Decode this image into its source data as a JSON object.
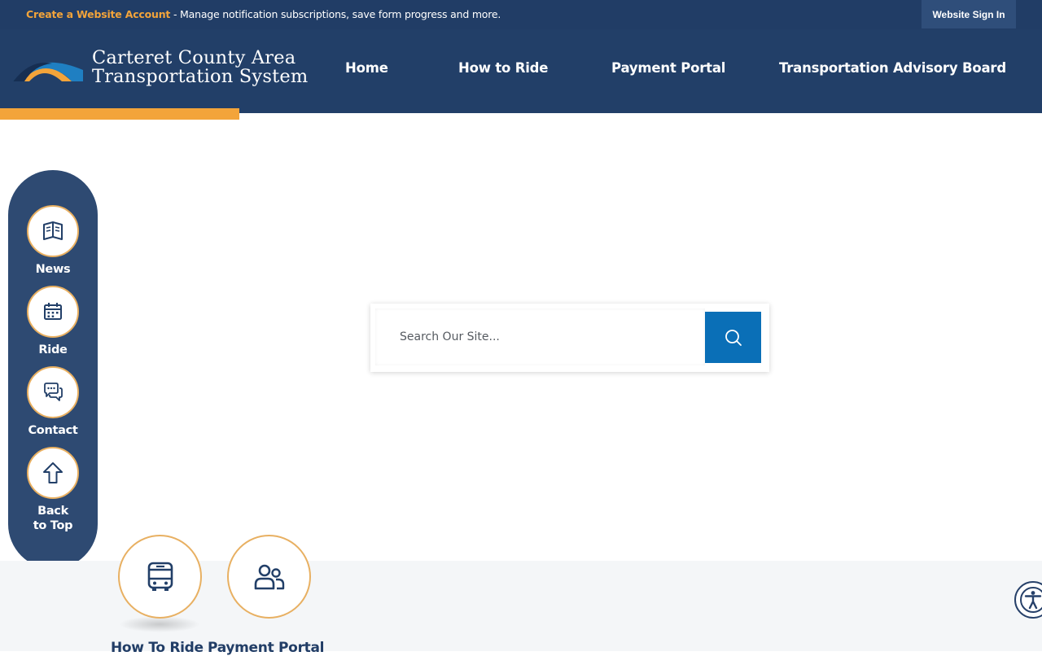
{
  "topbar": {
    "create_account_link": "Create a Website Account",
    "message": " - Manage notification subscriptions, save form progress and more.",
    "sign_in": "Website Sign In"
  },
  "header": {
    "site_name_line1": "Carteret County Area",
    "site_name_line2": "Transportation System",
    "nav": [
      "Home",
      "How to Ride",
      "Payment Portal",
      "Transportation Advisory Board"
    ]
  },
  "rail": {
    "items": [
      {
        "label": "News",
        "icon": "newspaper-icon"
      },
      {
        "label": "Ride",
        "icon": "calendar-icon"
      },
      {
        "label": "Contact",
        "icon": "chat-bubbles-icon"
      },
      {
        "label_line1": "Back",
        "label_line2": "to Top",
        "icon": "arrow-up-icon"
      }
    ]
  },
  "search": {
    "placeholder": "Search Our Site...",
    "icon": "search-icon"
  },
  "quick_links": {
    "items": [
      {
        "label": "How To Ride",
        "icon": "bus-icon"
      },
      {
        "label": "Payment Portal",
        "icon": "users-icon"
      }
    ]
  },
  "accessibility": {
    "icon": "accessibility-icon"
  },
  "colors": {
    "navy": "#223f68",
    "orange": "#f3a43a",
    "search_blue": "#0a6fb7",
    "rail": "#2e4a72"
  }
}
